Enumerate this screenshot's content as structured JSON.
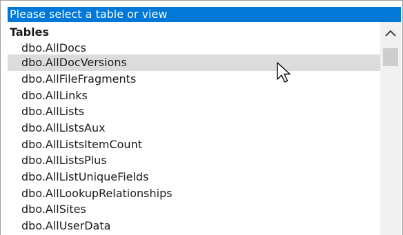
{
  "header": {
    "label": "Please select a table or view"
  },
  "group": {
    "label": "Tables"
  },
  "items": [
    {
      "label": "dbo.AllDocs"
    },
    {
      "label": "dbo.AllDocVersions"
    },
    {
      "label": "dbo.AllFileFragments"
    },
    {
      "label": "dbo.AllLinks"
    },
    {
      "label": "dbo.AllLists"
    },
    {
      "label": "dbo.AllListsAux"
    },
    {
      "label": "dbo.AllListsItemCount"
    },
    {
      "label": "dbo.AllListsPlus"
    },
    {
      "label": "dbo.AllListUniqueFields"
    },
    {
      "label": "dbo.AllLookupRelationships"
    },
    {
      "label": "dbo.AllSites"
    },
    {
      "label": "dbo.AllUserData"
    }
  ],
  "hovered_item": "dbo.AllDocVersions",
  "colors": {
    "header_bg": "#0078d7",
    "hover_bg": "#dcdcdc",
    "scrollbar_track": "#f0f0f0",
    "scrollbar_thumb": "#cdcdcd"
  },
  "icons": {
    "scroll_up": "chevron-up-icon",
    "pointer": "mouse-pointer-icon"
  }
}
